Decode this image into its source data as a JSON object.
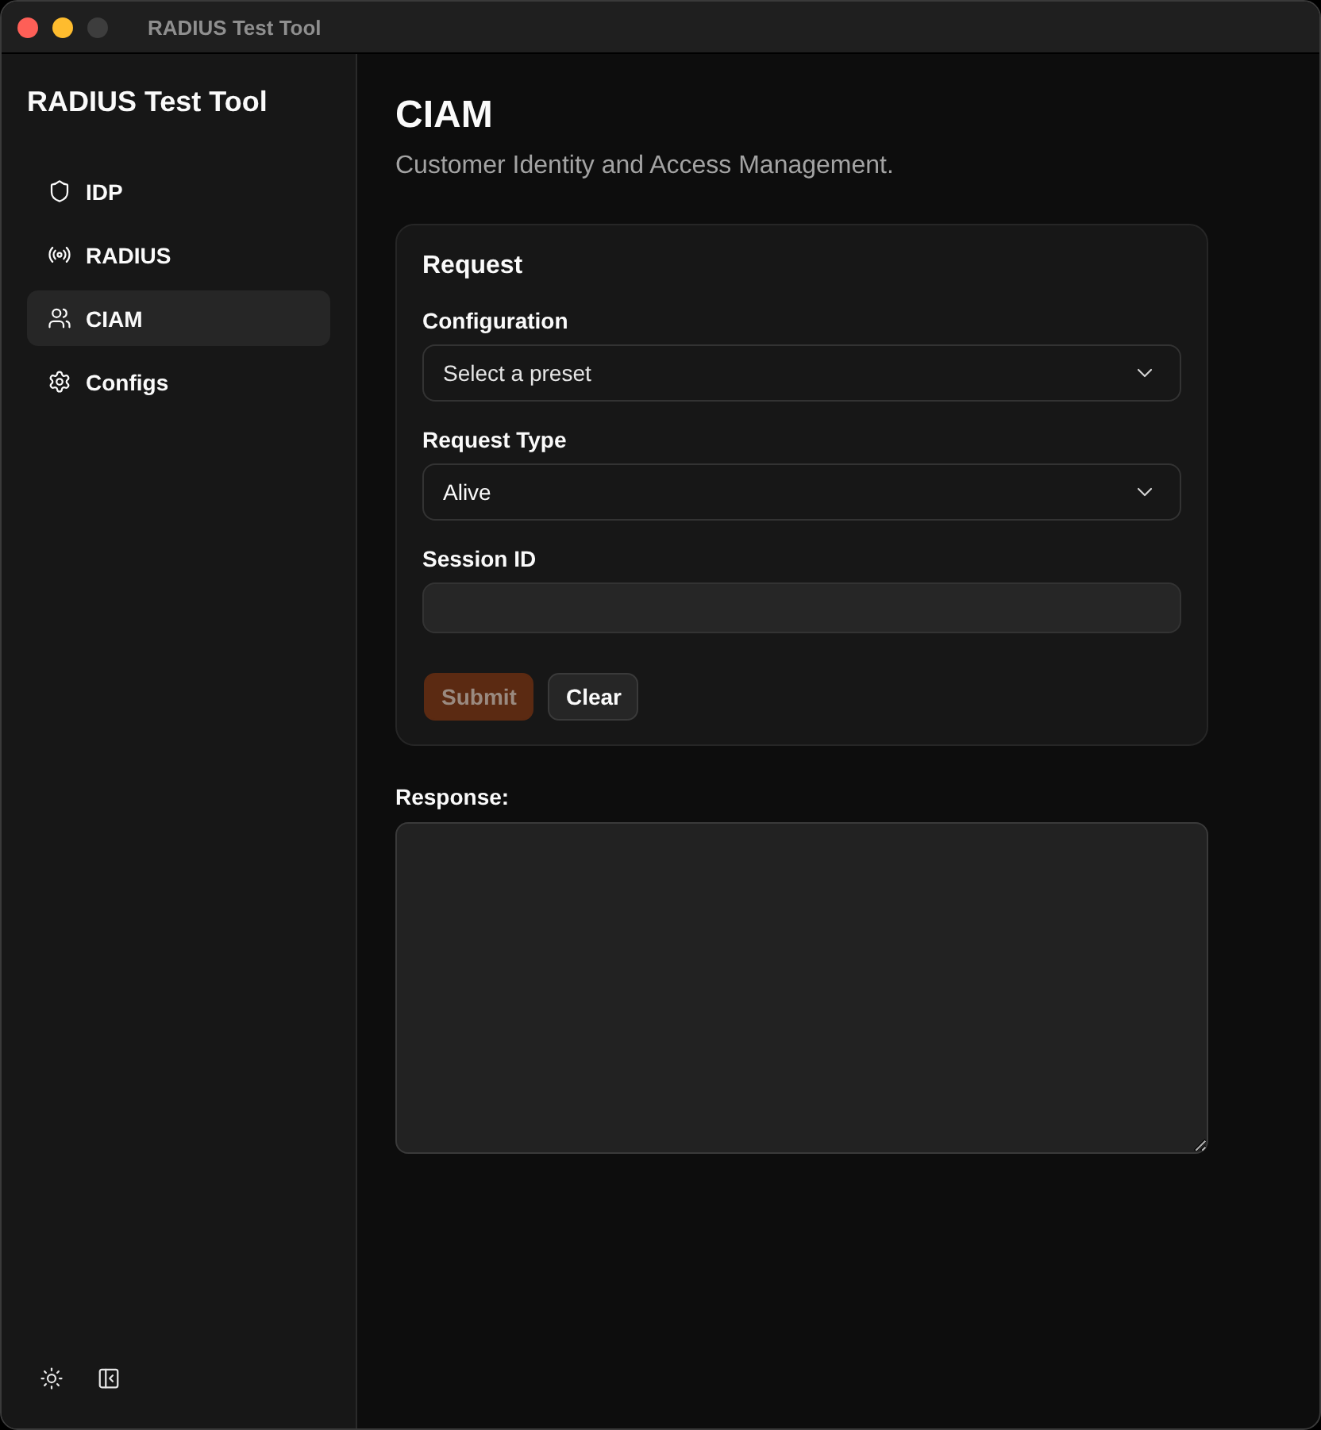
{
  "window": {
    "title": "RADIUS Test Tool"
  },
  "sidebar": {
    "title": "RADIUS Test Tool",
    "items": [
      {
        "label": "IDP",
        "selected": false
      },
      {
        "label": "RADIUS",
        "selected": false
      },
      {
        "label": "CIAM",
        "selected": true
      },
      {
        "label": "Configs",
        "selected": false
      }
    ]
  },
  "page": {
    "title": "CIAM",
    "subtitle": "Customer Identity and Access Management."
  },
  "request_card": {
    "title": "Request",
    "fields": [
      {
        "kind": "select",
        "label": "Configuration",
        "placeholder": "Select a preset"
      },
      {
        "kind": "select",
        "label": "Request Type",
        "value": "Alive"
      },
      {
        "kind": "text",
        "label": "Session ID"
      }
    ],
    "buttons": [
      {
        "label": "Submit",
        "kind": "primary",
        "disabled": true
      },
      {
        "label": "Clear",
        "kind": "secondary",
        "disabled": false
      }
    ]
  },
  "response": {
    "label": "Response:"
  }
}
